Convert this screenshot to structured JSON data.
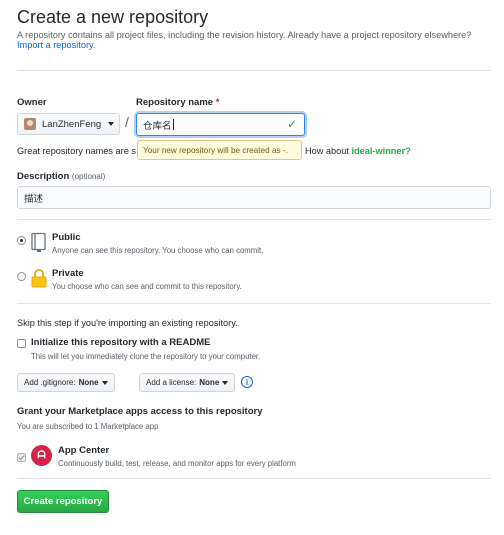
{
  "header": {
    "title": "Create a new repository",
    "intro": "A repository contains all project files, including the revision history. Already have a project repository elsewhere?",
    "import_link": "Import a repository."
  },
  "owner": {
    "label": "Owner",
    "value": "LanZhenFeng"
  },
  "repo_name": {
    "label": "Repository name",
    "required_mark": "*",
    "value": "仓库名",
    "separator": "/"
  },
  "name_hint": {
    "text": "Great repository names are s",
    "tooltip": "Your new repository will be created as -.",
    "how_about": "How about",
    "suggestion": "ideal-winner?"
  },
  "description": {
    "label": "Description",
    "optional": "(optional)",
    "value": "描述"
  },
  "visibility": {
    "public": {
      "title": "Public",
      "subtitle": "Anyone can see this repository. You choose who can commit."
    },
    "private": {
      "title": "Private",
      "subtitle": "You choose who can see and commit to this repository."
    }
  },
  "init": {
    "skip_text": "Skip this step if you're importing an existing repository.",
    "readme_label": "Initialize this repository with a README",
    "readme_sub": "This will let you immediately clone the repository to your computer.",
    "gitignore_prefix": "Add .gitignore:",
    "gitignore_value": "None",
    "license_prefix": "Add a license:",
    "license_value": "None",
    "info_symbol": "i"
  },
  "marketplace": {
    "heading": "Grant your Marketplace apps access to this repository",
    "subscribed_text": "You are subscribed to 1 Marketplace app",
    "app_name": "App Center",
    "app_desc": "Continuously build, test, release, and monitor apps for every platform",
    "app_icon_glyph": "ᗩ"
  },
  "submit_label": "Create repository"
}
